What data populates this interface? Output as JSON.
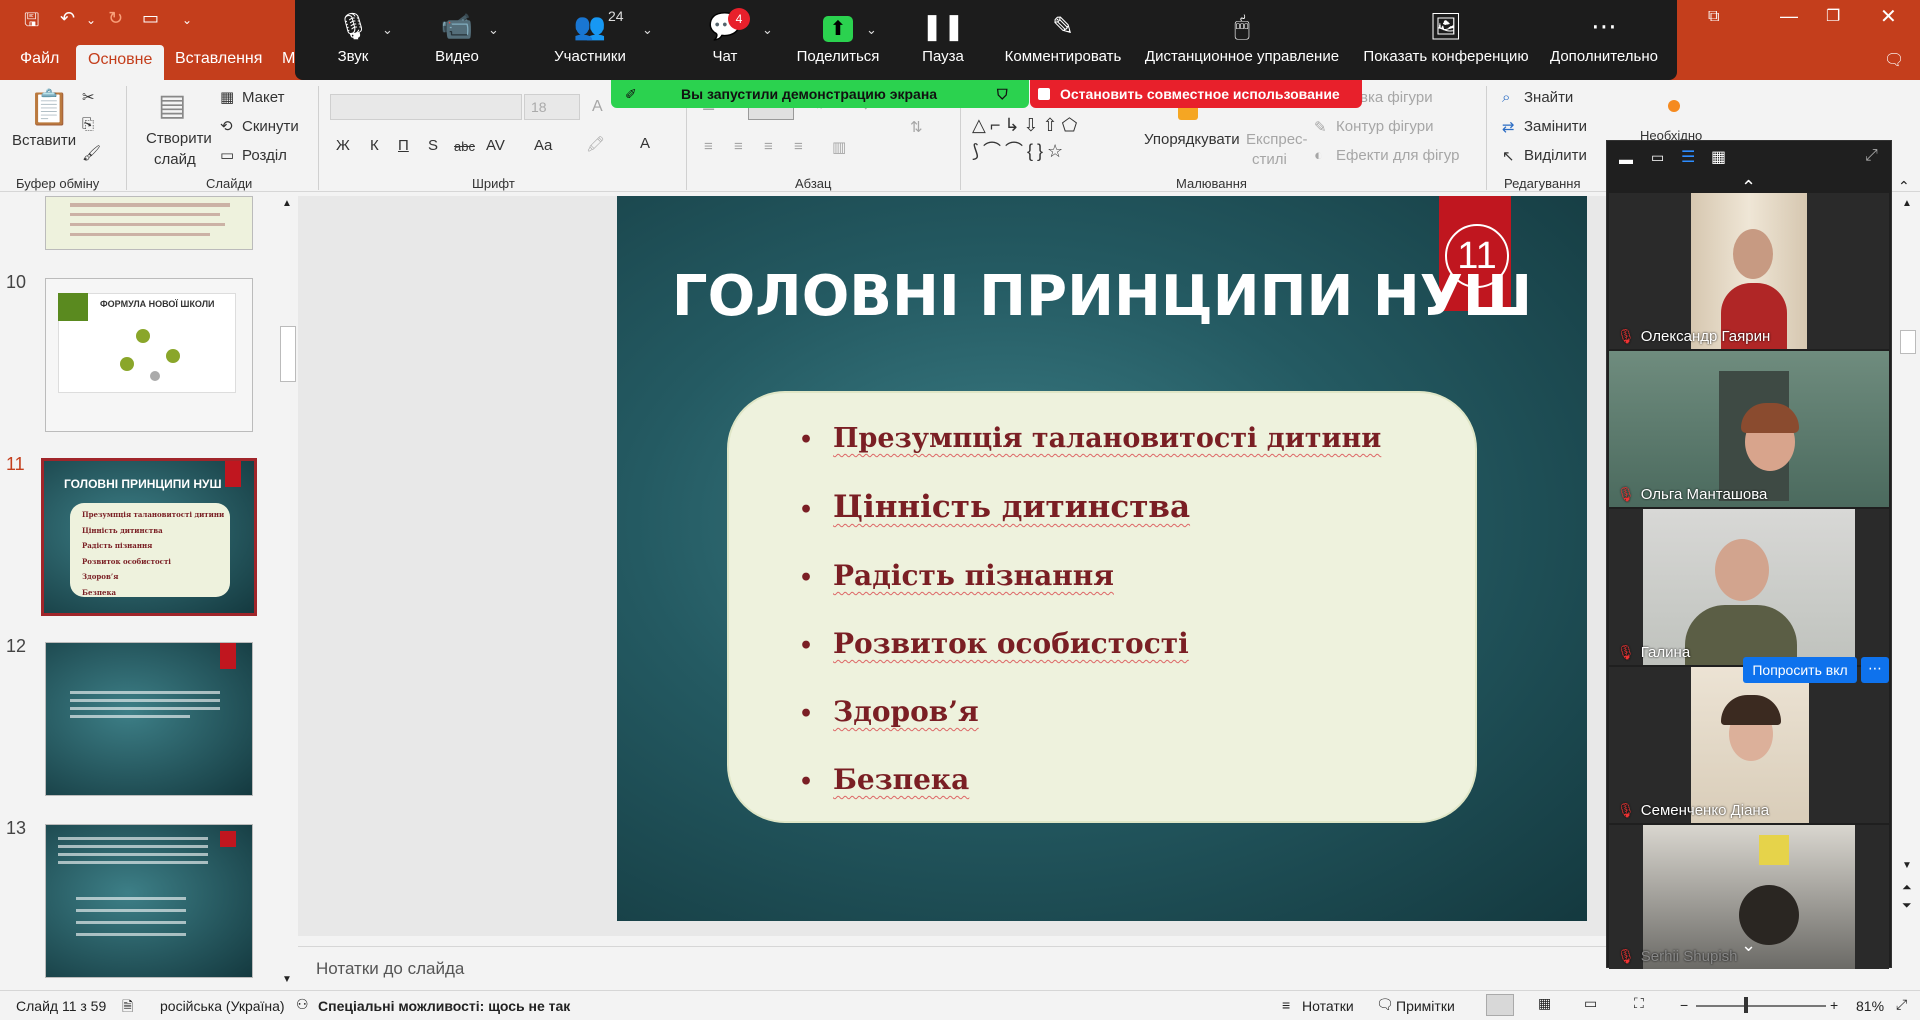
{
  "ribbon_tabs": [
    "Файл",
    "Основне",
    "Вставлення",
    "М"
  ],
  "active_tab": "Основне",
  "zoom_toolbar": {
    "items": [
      {
        "label": "Звук",
        "icon": "microphone-icon"
      },
      {
        "label": "Видео",
        "icon": "video-camera-icon"
      },
      {
        "label": "Участники",
        "icon": "participants-icon",
        "count": "24"
      },
      {
        "label": "Чат",
        "icon": "chat-icon",
        "badge": "4"
      },
      {
        "label": "Поделиться",
        "icon": "share-screen-icon"
      },
      {
        "label": "Пауза",
        "icon": "pause-icon"
      },
      {
        "label": "Комментировать",
        "icon": "pen-icon"
      },
      {
        "label": "Дистанционное управление",
        "icon": "mouse-icon"
      },
      {
        "label": "Показать конференцию",
        "icon": "show-meeting-icon"
      },
      {
        "label": "Дополнительно",
        "icon": "more-icon"
      }
    ]
  },
  "share_banner": {
    "started": "Вы запустили демонстрацию экрана",
    "stop": "Остановить совместное использование"
  },
  "ribbon": {
    "clipboard": {
      "paste": "Вставити",
      "group": "Буфер обміну"
    },
    "slides": {
      "new_slide_1": "Створити",
      "new_slide_2": "слайд",
      "layout": "Макет",
      "reset": "Скинути",
      "section": "Розділ",
      "group": "Слайди"
    },
    "font": {
      "size": "18",
      "bold": "Ж",
      "italic": "К",
      "underline": "П",
      "shadow": "S",
      "strike": "abc",
      "spacing": "AV",
      "case": "Aa",
      "group": "Шрифт"
    },
    "paragraph": {
      "group": "Абзац"
    },
    "drawing": {
      "arrange": "Упорядкувати",
      "quick_1": "Експрес-",
      "quick_2": "стилі",
      "fill": "вка фігури",
      "outline": "Контур фігури",
      "effects": "Ефекти для фігур",
      "group": "Малювання"
    },
    "editing": {
      "find": "Знайти",
      "replace": "Замінити",
      "select": "Виділити",
      "group": "Редагування"
    },
    "extra": "Необхідно"
  },
  "thumbnails": [
    {
      "num": "10",
      "title": "ФОРМУЛА НОВОЇ ШКОЛИ"
    },
    {
      "num": "11",
      "title": "ГОЛОВНІ ПРИНЦИПИ НУШ",
      "items": [
        "Презумпція талановитості дитини",
        "Цінність дитинства",
        "Радість пізнання",
        "Розвиток особистості",
        "Здоров’я",
        "Безпека"
      ]
    },
    {
      "num": "12"
    },
    {
      "num": "13"
    }
  ],
  "slide": {
    "title": "ГОЛОВНІ ПРИНЦИПИ НУШ",
    "number": "11",
    "bullets": [
      "Презумпція талановитості дитини",
      "Цінність дитинства",
      "Радість пізнання",
      "Розвиток особистості",
      "Здоров’я",
      "Безпека"
    ]
  },
  "notes_placeholder": "Нотатки до слайда",
  "status": {
    "slide": "Слайд 11 з 59",
    "language": "російська (Україна)",
    "accessibility": "Спеціальні можливості: щось не так",
    "notes": "Нотатки",
    "comments": "Примітки",
    "zoom": "81%"
  },
  "participants": [
    {
      "name": "Олександр Гаярин"
    },
    {
      "name": "Ольга Манташова"
    },
    {
      "name": "Галина"
    },
    {
      "name": "Семенченко Діана"
    },
    {
      "name": "Serhii Shupish"
    }
  ],
  "ask_unmute": "Попросить вкл",
  "colors": {
    "ppt_red": "#c43e1c",
    "zoom_green": "#2bd24f",
    "stop_red": "#e8202b",
    "bullet_text": "#7a1f24"
  }
}
